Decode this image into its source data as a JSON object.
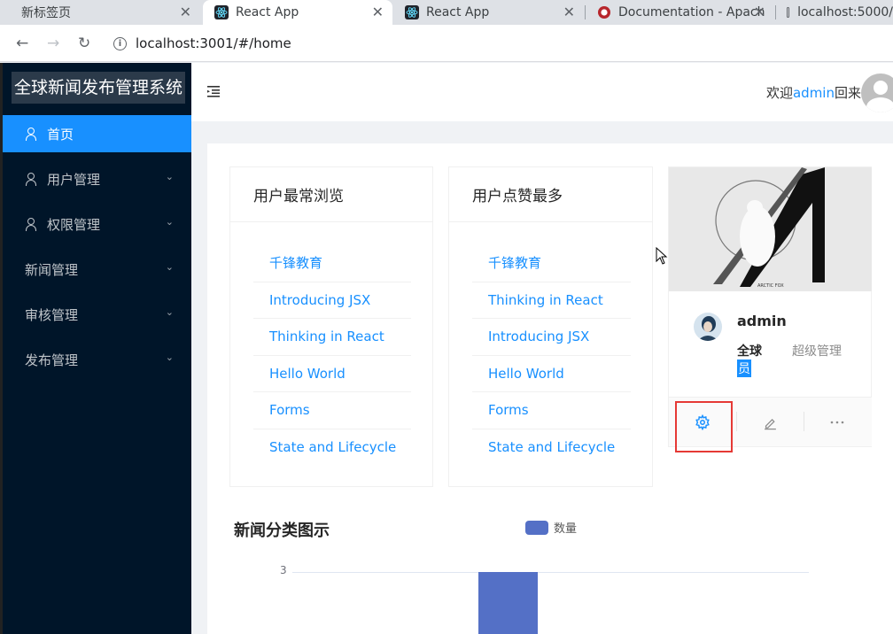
{
  "browser": {
    "tabs": [
      {
        "title": "新标签页"
      },
      {
        "title": "React App"
      },
      {
        "title": "React App"
      },
      {
        "title": "Documentation - Apach"
      },
      {
        "title": "localhost:5000/"
      }
    ],
    "url": "localhost:3001/#/home",
    "close_glyph": "✕"
  },
  "sidebar": {
    "logo": "全球新闻发布管理系统",
    "items": [
      {
        "label": "首页",
        "icon": "user-icon",
        "selected": true
      },
      {
        "label": "用户管理",
        "icon": "user-icon"
      },
      {
        "label": "权限管理",
        "icon": "user-icon"
      },
      {
        "label": "新闻管理"
      },
      {
        "label": "审核管理"
      },
      {
        "label": "发布管理"
      }
    ]
  },
  "header": {
    "welcome_prefix": "欢迎",
    "username": "admin",
    "welcome_suffix": "回来"
  },
  "cards": {
    "most_viewed": {
      "title": "用户最常浏览",
      "items": [
        "千锋教育",
        "Introducing JSX",
        "Thinking in React",
        "Hello World",
        "Forms",
        "State and Lifecycle"
      ]
    },
    "most_liked": {
      "title": "用户点赞最多",
      "items": [
        "千锋教育",
        "Thinking in React",
        "Introducing JSX",
        "Hello World",
        "Forms",
        "State and Lifecycle"
      ]
    },
    "profile": {
      "cover_caption": "ARCTIC FOX",
      "name": "admin",
      "region": "全球",
      "role": "超级管理",
      "role_wrap": "员",
      "actions": [
        "setting-icon",
        "edit-icon",
        "ellipsis-icon"
      ]
    }
  },
  "chart": {
    "title": "新闻分类图示",
    "legend": "数量",
    "tick_label": "3"
  },
  "chart_data": {
    "type": "bar",
    "title": "新闻分类图示",
    "series": [
      {
        "name": "数量",
        "values": [
          3
        ]
      }
    ],
    "y_ticks": [
      3
    ],
    "color": "#5470c6"
  },
  "colors": {
    "primary": "#1890ff",
    "sider": "#001529",
    "bar": "#5470c6",
    "highlight_box": "#e53935"
  }
}
